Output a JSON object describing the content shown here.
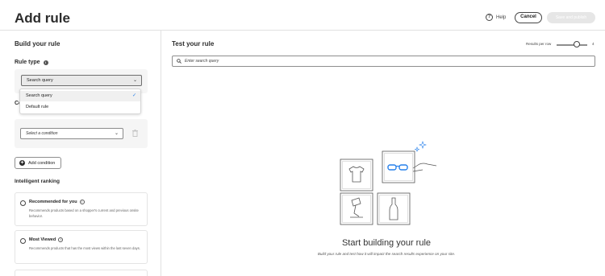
{
  "header": {
    "title": "Add rule",
    "help_label": "Help",
    "cancel_label": "Cancel",
    "save_label": "Save and publish"
  },
  "left_panel": {
    "build_heading": "Build your rule",
    "rule_type_heading": "Rule type",
    "rule_type_selected": "Search query",
    "rule_type_options": [
      {
        "label": "Search query",
        "selected": true
      },
      {
        "label": "Default rule",
        "selected": false
      }
    ],
    "conditions_heading_visible": "Co",
    "condition_select_placeholder": "Select a condition",
    "add_condition_label": "Add condition",
    "intelligent_ranking_heading": "Intelligent ranking",
    "ranking_options": [
      {
        "title": "Recommended for you",
        "description": "Recommends products based on a shopper's current and previous onsite behavior."
      },
      {
        "title": "Most Viewed",
        "description": "Recommends products that has the most views within the last seven days."
      }
    ]
  },
  "right_panel": {
    "test_heading": "Test your rule",
    "results_per_row_label": "Results per row",
    "results_per_row_value": "4",
    "results_per_row_fraction": 0.55,
    "search_placeholder": "Enter search query",
    "empty_title": "Start building your rule",
    "empty_subtitle": "Build your rule and test how it will impact the search results experience on your site."
  },
  "colors": {
    "accent": "#2680eb",
    "text": "#2c2c2c",
    "border": "#e1e1e1"
  },
  "icons": [
    "help-icon",
    "info-icon",
    "chevron-down-icon",
    "check-icon",
    "trash-icon",
    "plus-icon",
    "search-icon",
    "sparkle-icon"
  ]
}
